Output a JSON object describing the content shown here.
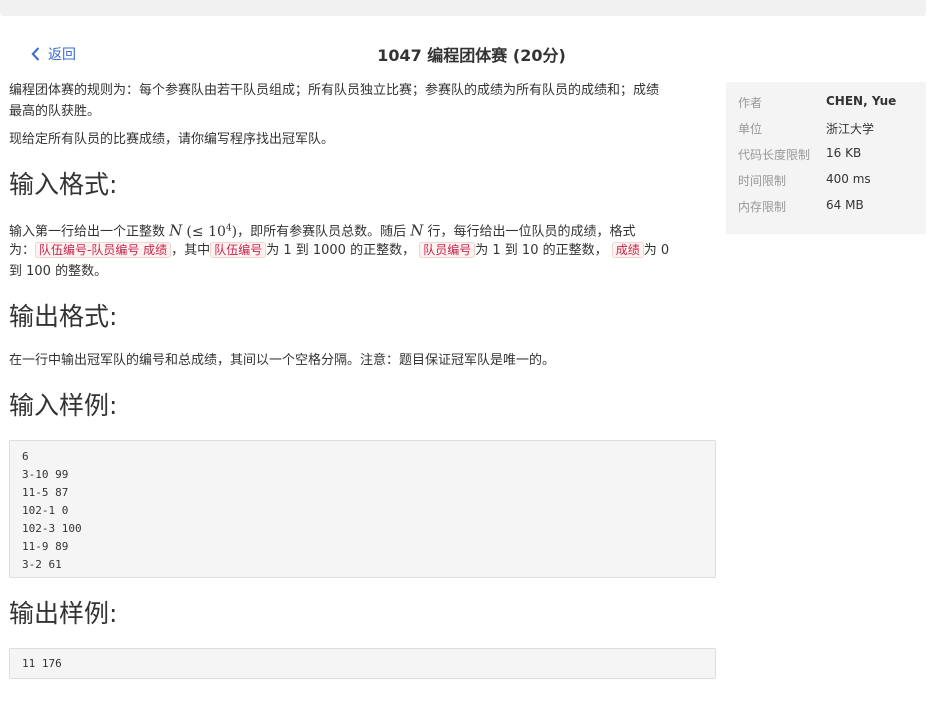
{
  "nav": {
    "back_label": "返回"
  },
  "problem": {
    "title": "1047 编程团体赛 (20分)",
    "intro_line1": "编程团体赛的规则为：每个参赛队由若干队员组成；所有队员独立比赛；参赛队的成绩为所有队员的成绩和；成绩",
    "intro_line2": "最高的队获胜。",
    "intro_p2": "现给定所有队员的比赛成绩，请你编写程序找出冠军队。",
    "input_heading": "输入格式:",
    "input_line1_a": "输入第一行给出一个正整数",
    "input_line1_math_n": "N",
    "input_line1_math_le": "(≤ 10",
    "input_line1_math_exp": "4",
    "input_line1_math_close": ")",
    "input_line1_b": "，即所有参赛队员总数。随后",
    "input_line1_c": "行，每行给出一位队员的成绩，格式",
    "input_line2_a": "为：",
    "input_code_format": "队伍编号-队员编号 成绩",
    "input_line2_b": "，其中",
    "input_code_team": "队伍编号",
    "input_line2_c": "为 1 到 1000 的正整数，",
    "input_code_member": "队员编号",
    "input_line2_d": "为 1 到 10 的正整数，",
    "input_code_score": "成绩",
    "input_line2_e": "为 0",
    "input_line3": "到 100 的整数。",
    "output_heading": "输出格式:",
    "output_text": "在一行中输出冠军队的编号和总成绩，其间以一个空格分隔。注意：题目保证冠军队是唯一的。",
    "sample_input_heading": "输入样例:",
    "sample_input_lines": [
      "6",
      "3-10 99",
      "11-5 87",
      "102-1 0",
      "102-3 100",
      "11-9 89",
      "3-2 61"
    ],
    "sample_output_heading": "输出样例:",
    "sample_output": "11 176"
  },
  "info": {
    "author_label": "作者",
    "author_value": "CHEN, Yue",
    "unit_label": "单位",
    "unit_value": "浙江大学",
    "code_len_label": "代码长度限制",
    "code_len_value": "16 KB",
    "time_label": "时间限制",
    "time_value": "400 ms",
    "mem_label": "内存限制",
    "mem_value": "64 MB"
  },
  "colors": {
    "link": "#3a6bd6",
    "code_text": "#c7254e",
    "side_bg": "#f4f4f4"
  }
}
